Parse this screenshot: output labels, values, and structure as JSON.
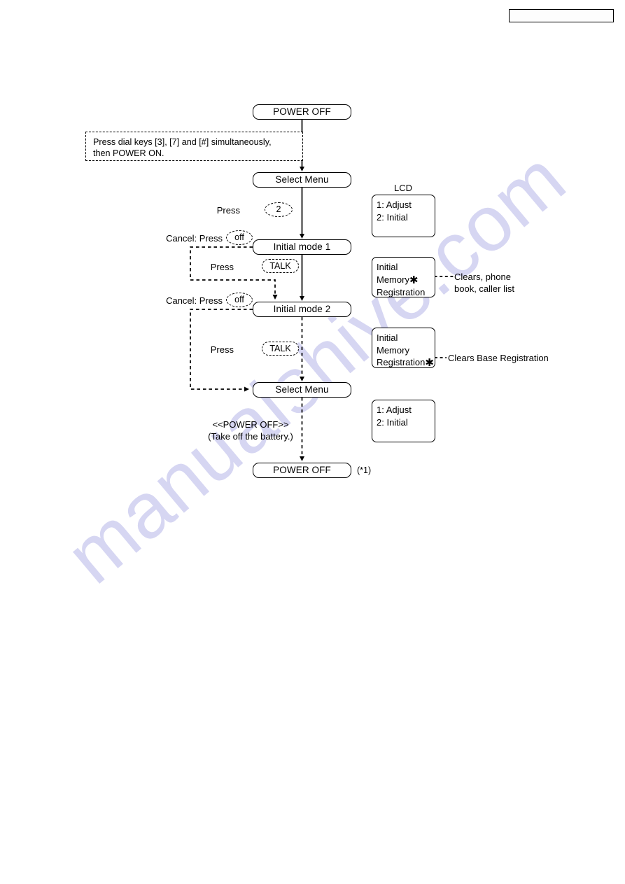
{
  "page": {
    "watermark_text": "manualshive.com",
    "watermark_color": "#d6d6f2"
  },
  "header": {
    "box_label": ""
  },
  "flow": {
    "nodes": [
      {
        "id": "power-off-top",
        "label": "POWER OFF"
      },
      {
        "id": "select-menu-1",
        "label": "Select Menu"
      },
      {
        "id": "initial-mode-1",
        "label": "Initial mode 1"
      },
      {
        "id": "initial-mode-2",
        "label": "Initial mode 2"
      },
      {
        "id": "select-menu-2",
        "label": "Select Menu"
      },
      {
        "id": "power-off-bottom",
        "label": "POWER OFF"
      }
    ],
    "note": {
      "line1": "Press dial keys [3], [7] and [#] simultaneously,",
      "line2": "then POWER ON."
    },
    "actions": [
      {
        "id": "press-2",
        "prefix": "Press",
        "key": "2"
      },
      {
        "id": "press-talk-1",
        "prefix": "Press",
        "key": "TALK"
      },
      {
        "id": "press-talk-2",
        "prefix": "Press",
        "key": "TALK"
      }
    ],
    "cancels": [
      {
        "id": "cancel-1",
        "prefix": "Cancel: Press",
        "key": "off"
      },
      {
        "id": "cancel-2",
        "prefix": "Cancel: Press",
        "key": "off"
      }
    ],
    "power_off_note": {
      "line1": "<<POWER OFF>>",
      "line2": "(Take off the battery.)"
    },
    "footnote": "(*1)"
  },
  "lcd": {
    "title": "LCD",
    "screens": [
      {
        "id": "lcd-adjust-initial-1",
        "lines": [
          "1: Adjust",
          "2: Initial"
        ],
        "asterisk_line": -1,
        "callout": ""
      },
      {
        "id": "lcd-initial-memory-registration",
        "lines": [
          "Initial",
          "Memory",
          "Registration"
        ],
        "asterisk_line": 1,
        "callout_line1": "Clears, phone",
        "callout_line2": "book, caller list"
      },
      {
        "id": "lcd-initial-memory-registration-2",
        "lines": [
          "Initial",
          "Memory",
          "Registration"
        ],
        "asterisk_line": 2,
        "callout_line1": "Clears Base Registration",
        "callout_line2": ""
      },
      {
        "id": "lcd-adjust-initial-2",
        "lines": [
          "1: Adjust",
          "2: Initial"
        ],
        "asterisk_line": -1,
        "callout": ""
      }
    ]
  }
}
